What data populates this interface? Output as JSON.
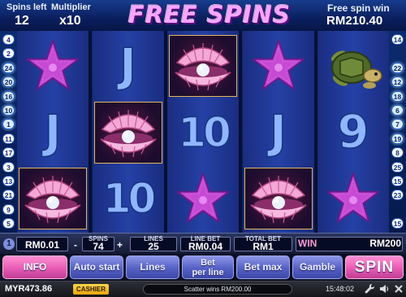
{
  "header": {
    "spins_left_label": "Spins left",
    "spins_left_value": "12",
    "multiplier_label": "Multiplier",
    "multiplier_value": "x10",
    "title": "FREE SPINS",
    "free_spin_win_label": "Free spin win",
    "free_spin_win_value": "RM210.40"
  },
  "paylines": {
    "left": [
      "4",
      "2",
      "24",
      "20",
      "16",
      "10",
      "1",
      "11",
      "17",
      "3",
      "13",
      "21",
      "9",
      "5"
    ],
    "right": [
      "14",
      "",
      "22",
      "12",
      "18",
      "6",
      "7",
      "19",
      "8",
      "25",
      "15",
      "23",
      "",
      "15"
    ]
  },
  "reels": [
    [
      "starfish",
      "card-j",
      "pearl-shell"
    ],
    [
      "card-j",
      "pearl-shell",
      "card-10"
    ],
    [
      "pearl-shell",
      "card-10",
      "starfish"
    ],
    [
      "starfish",
      "card-j",
      "pearl-shell"
    ],
    [
      "turtle",
      "card-9",
      "starfish"
    ]
  ],
  "card_text": {
    "card-j": "J",
    "card-10": "10",
    "card-9": "9"
  },
  "controls": {
    "coin_index": "1",
    "coin_value": "RM0.01",
    "spins_label": "SPINS",
    "spins_value": "74",
    "minus": "-",
    "plus": "+",
    "lines_label": "LINES",
    "lines_value": "25",
    "line_bet_label": "LINE BET",
    "line_bet_value": "RM0.04",
    "total_bet_label": "TOTAL BET",
    "total_bet_value": "RM1",
    "win_label": "WIN",
    "win_value": "RM200"
  },
  "buttons": {
    "info": "INFO",
    "auto_start": "Auto start",
    "lines": "Lines",
    "bet_per_line_1": "Bet",
    "bet_per_line_2": "per line",
    "bet_max": "Bet max",
    "gamble": "Gamble",
    "spin": "SPIN"
  },
  "status": {
    "balance": "MYR473.86",
    "cashier": "CASHIER",
    "message": "Scatter wins RM200.00",
    "time": "15:48:02"
  },
  "colors": {
    "title": "#f6a6ff",
    "button_blue": "#5560c4",
    "button_pink": "#e75cb5",
    "starfish": "#c64ad3",
    "shell": "#f3a8d6",
    "card": "#8fb6ff"
  },
  "icons": [
    "wrench-icon",
    "speaker-icon",
    "close-icon",
    "starfish-icon",
    "pearl-shell-icon",
    "turtle-icon"
  ]
}
